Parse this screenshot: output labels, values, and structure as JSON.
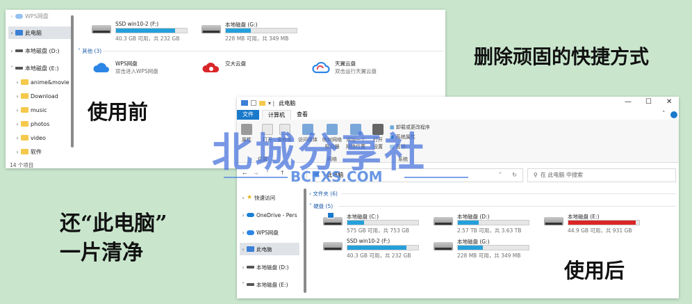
{
  "before_window": {
    "sidebar": [
      {
        "label": "WPS网盘"
      },
      {
        "label": "此电脑"
      },
      {
        "label": "本地磁盘 (D:)"
      },
      {
        "label": "本地磁盘 (E:)"
      },
      {
        "label": "anime&movie"
      },
      {
        "label": "Download"
      },
      {
        "label": "music"
      },
      {
        "label": "photos"
      },
      {
        "label": "video"
      },
      {
        "label": "软件"
      }
    ],
    "item_count": "14 个项目",
    "drives": [
      {
        "name": "SSD win10-2 (F:)",
        "capacity": "40.3 GB 可用，共 232 GB",
        "used_fraction": 0.83
      },
      {
        "name": "本地磁盘 (G:)",
        "capacity": "228 MB 可用，共 349 MB",
        "used_fraction": 0.35
      }
    ],
    "other_group": "其他 (3)",
    "other_items": [
      {
        "name": "WPS网盘",
        "sub": "双击进入WPS网盘",
        "icon": "wps-cloud-icon"
      },
      {
        "name": "交大云盘",
        "sub": "",
        "icon": "jiaoda-cloud-icon"
      },
      {
        "name": "天翼云盘",
        "sub": "双击运行天翼云盘",
        "icon": "tianyi-cloud-icon"
      }
    ]
  },
  "labels": {
    "title_right": "删除顽固的快捷方式",
    "before": "使用前",
    "left_line1": "还“此电脑”",
    "left_line2": "一片清净",
    "after": "使用后"
  },
  "after_window": {
    "title": "此电脑",
    "tabs": [
      "文件",
      "计算机",
      "查看"
    ],
    "ribbon": [
      {
        "label": "属性"
      },
      {
        "label": "打开"
      },
      {
        "label": "重命名"
      },
      {
        "label": "访问媒体"
      },
      {
        "label": "映射网络驱动器"
      },
      {
        "label": "添加一个网络位置"
      },
      {
        "label": "打开设置"
      },
      {
        "label": "卸载或更改程序"
      },
      {
        "label": "系统属性"
      },
      {
        "label": "管理"
      }
    ],
    "ribbon_groups": [
      "位置",
      "网络",
      "系统"
    ],
    "address": "此电脑",
    "search_placeholder": "在 此电脑 中搜索",
    "folders_group": "文件夹 (6)",
    "devices_group": "硬盘 (5)",
    "sidebar": [
      {
        "label": "快速访问"
      },
      {
        "label": "OneDrive - Pers"
      },
      {
        "label": "WPS网盘"
      },
      {
        "label": "此电脑"
      },
      {
        "label": "本地磁盘 (D:)"
      },
      {
        "label": "本地磁盘 (E:)"
      }
    ],
    "drives": [
      {
        "name": "本地磁盘 (C:)",
        "capacity": "575 GB 可用，共 753 GB",
        "used_fraction": 0.24,
        "color": "#26a0da"
      },
      {
        "name": "本地磁盘 (D:)",
        "capacity": "2.57 TB 可用，共 3.63 TB",
        "used_fraction": 0.29,
        "color": "#26a0da"
      },
      {
        "name": "本地磁盘 (E:)",
        "capacity": "44.9 GB 可用，共 931 GB",
        "used_fraction": 0.95,
        "color": "#da2626"
      },
      {
        "name": "SSD win10-2 (F:)",
        "capacity": "40.3 GB 可用，共 232 GB",
        "used_fraction": 0.83,
        "color": "#26a0da"
      },
      {
        "name": "本地磁盘 (G:)",
        "capacity": "228 MB 可用，共 349 MB",
        "used_fraction": 0.35,
        "color": "#26a0da"
      }
    ]
  },
  "watermark": {
    "text": "北城分享社",
    "url": "BCFXS.COM"
  }
}
